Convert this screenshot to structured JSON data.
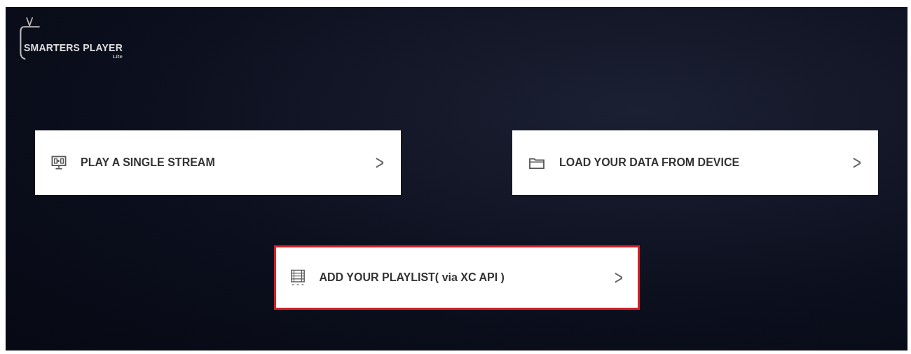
{
  "logo": {
    "title": "SMARTERS PLAYER",
    "subtitle": "Lite"
  },
  "options": [
    {
      "kind": "monitor",
      "label": "PLAY A SINGLE STREAM",
      "arrow": ">",
      "selected": false
    },
    {
      "kind": "folder",
      "label": "LOAD YOUR DATA FROM DEVICE",
      "arrow": ">",
      "selected": false
    },
    {
      "kind": "list",
      "label": "ADD YOUR PLAYLIST( via XC API )",
      "arrow": ">",
      "selected": true
    }
  ]
}
